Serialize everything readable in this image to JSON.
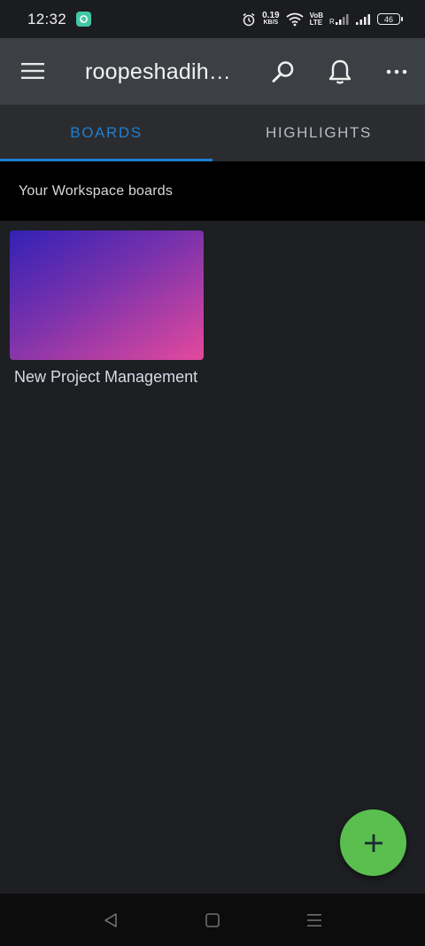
{
  "status_bar": {
    "time": "12:32",
    "net_speed_value": "0.19",
    "net_speed_unit": "KB/S",
    "volte_top": "VoB",
    "volte_bottom": "LTE",
    "battery": "46"
  },
  "app_bar": {
    "title": "roopeshadih…",
    "icons": [
      "menu-icon",
      "search-icon",
      "bell-icon",
      "more-icon"
    ]
  },
  "tabs": [
    {
      "label": "BOARDS",
      "active": true
    },
    {
      "label": "HIGHLIGHTS",
      "active": false
    }
  ],
  "section": {
    "title": "Your Workspace boards"
  },
  "boards": [
    {
      "name": "New Project Management"
    }
  ],
  "fab": {
    "icon": "plus-icon"
  },
  "colors": {
    "accent_blue": "#1f7fd1",
    "fab_green": "#5abf4f",
    "app_bar": "#3c3f44",
    "background": "#1d1f23"
  }
}
